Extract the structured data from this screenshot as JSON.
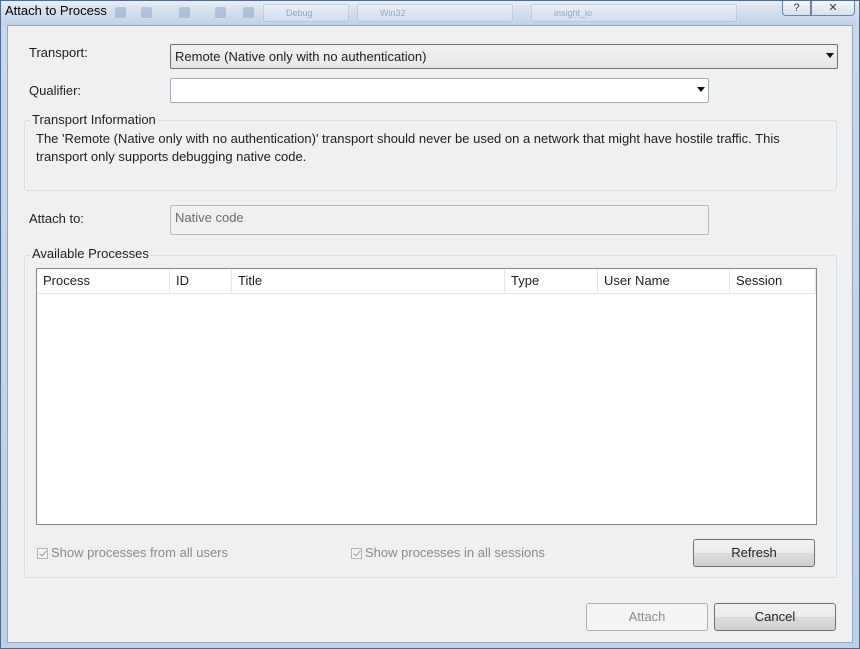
{
  "window": {
    "title": "Attach to Process"
  },
  "titlebar_ghost": {
    "items": [
      "Debug",
      "Win32",
      "insight_io"
    ]
  },
  "caption": {
    "help_label": "?",
    "close_label": "✕"
  },
  "form": {
    "transport_label": "Transport:",
    "transport_value": "Remote (Native only with no authentication)",
    "qualifier_label": "Qualifier:",
    "qualifier_value": ""
  },
  "transport_info": {
    "title": "Transport Information",
    "line1": "The 'Remote (Native only with no authentication)' transport should never be used on a network that might have hostile traffic. This",
    "line2": "transport only supports debugging native code."
  },
  "attach_to": {
    "label": "Attach to:",
    "value": "Native code"
  },
  "processes": {
    "title": "Available Processes",
    "columns": [
      "Process",
      "ID",
      "Title",
      "Type",
      "User Name",
      "Session"
    ],
    "rows": [],
    "show_all_users": {
      "label": "Show processes from all users",
      "checked": true,
      "enabled": false
    },
    "show_all_sessions": {
      "label": "Show processes in all sessions",
      "checked": true,
      "enabled": false
    },
    "refresh_label": "Refresh"
  },
  "footer": {
    "attach_label": "Attach",
    "cancel_label": "Cancel"
  }
}
